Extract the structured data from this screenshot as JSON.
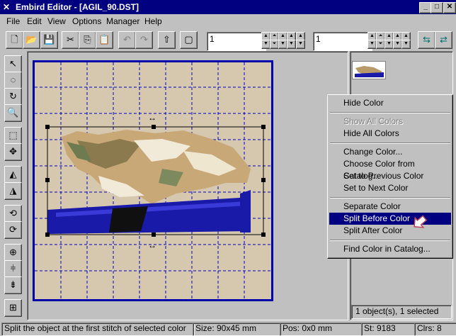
{
  "window": {
    "title": "Embird Editor - [AGIL_90.DST]"
  },
  "menu": [
    "File",
    "Edit",
    "View",
    "Options",
    "Manager",
    "Help"
  ],
  "toolbar": {
    "field1_value": "1",
    "field2_value": "1"
  },
  "context_menu": {
    "items": [
      {
        "label": "Hide Color",
        "state": "normal"
      },
      {
        "label": "Show All Colors",
        "state": "disabled"
      },
      {
        "label": "Hide All Colors",
        "state": "normal"
      },
      {
        "label": "Change Color...",
        "state": "normal"
      },
      {
        "label": "Choose Color from Catalog...",
        "state": "normal"
      },
      {
        "label": "Set to Previous Color",
        "state": "normal"
      },
      {
        "label": "Set to Next Color",
        "state": "normal"
      },
      {
        "label": "Separate Color",
        "state": "normal"
      },
      {
        "label": "Split Before Color",
        "state": "selected"
      },
      {
        "label": "Split After Color",
        "state": "normal"
      },
      {
        "label": "Find Color in Catalog...",
        "state": "normal"
      }
    ]
  },
  "right_panel": {
    "selection_info": "1 object(s), 1 selected"
  },
  "palette_colors": [
    "#8b7d5a",
    "#e8dcc0",
    "#f4ecd8",
    "#d0c8a0",
    "#708060",
    "#404040",
    "#1a1a8c",
    "#101010"
  ],
  "statusbar": {
    "hint": "Split the object at the first stitch of selected color",
    "size": "Size: 90x45 mm",
    "pos": "Pos: 0x0 mm",
    "stitches": "St: 9183",
    "colors": "Clrs: 8"
  }
}
